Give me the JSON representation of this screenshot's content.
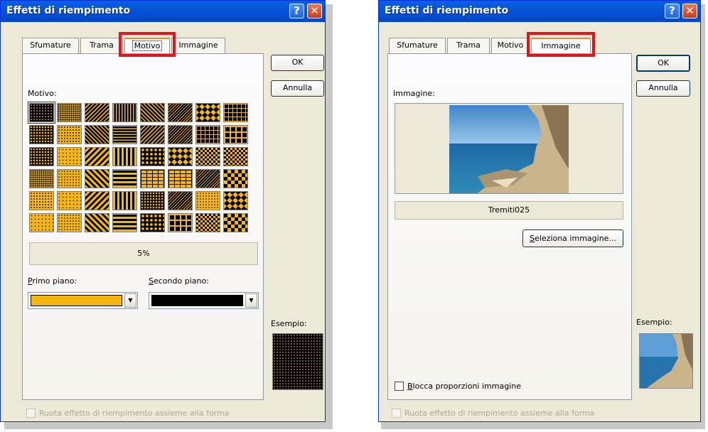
{
  "left_dialog": {
    "title": "Effetti di riempimento",
    "tabs": [
      "Sfumature",
      "Trama",
      "Motivo",
      "Immagine"
    ],
    "active_tab": "Motivo",
    "ok_label": "OK",
    "cancel_label": "Annulla",
    "pattern_label": "Motivo:",
    "pattern_name": "5%",
    "foreground_label": "Primo piano:",
    "background_label": "Secondo piano:",
    "foreground_color": "#f5b614",
    "background_color": "#000000",
    "sample_label": "Esempio:",
    "rotate_label": "Ruota effetto di riempimento assieme alla forma"
  },
  "right_dialog": {
    "title": "Effetti di riempimento",
    "tabs": [
      "Sfumature",
      "Trama",
      "Motivo",
      "Immagine"
    ],
    "active_tab": "Immagine",
    "ok_label": "OK",
    "cancel_label": "Annulla",
    "picture_label": "Immagine:",
    "picture_name": "Tremiti025",
    "select_picture_label": "Seleziona immagine...",
    "lock_ratio_label": "Blocca proporzioni immagine",
    "sample_label": "Esempio:",
    "rotate_label": "Ruota effetto di riempimento assieme alla forma"
  },
  "colors": {
    "title_bar": "#0553d6",
    "highlight": "#e3141a",
    "dialog_bg": "#ece9d8"
  }
}
